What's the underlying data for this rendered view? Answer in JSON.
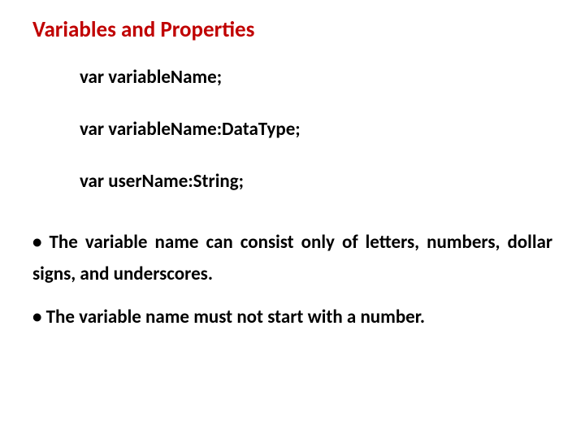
{
  "title": "Variables and Properties",
  "code": {
    "line1": "var variableName;",
    "line2": "var variableName:DataType;",
    "line3": "var userName:String;"
  },
  "bullets": {
    "b1": "• The variable name can consist only of letters, numbers, dollar signs, and underscores.",
    "b2": "• The variable name must not start with a number."
  }
}
